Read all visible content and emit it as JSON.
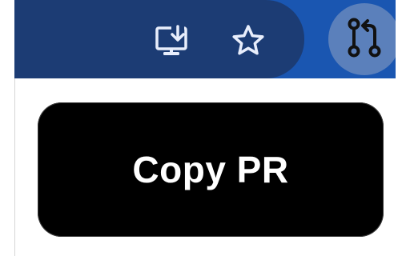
{
  "toolbar": {
    "icons": {
      "install": "install-app-icon",
      "bookmark": "bookmark-star-icon",
      "extension": "git-pull-request-icon"
    },
    "colors": {
      "toolbar_bg": "#1a56b1",
      "omnibox_bg": "#1c3c74",
      "extension_bg": "#5b80bb",
      "icon_color": "#e8eefc"
    }
  },
  "popup": {
    "copy_button_label": "Copy PR",
    "colors": {
      "button_bg": "#000000",
      "button_text": "#ffffff"
    }
  }
}
